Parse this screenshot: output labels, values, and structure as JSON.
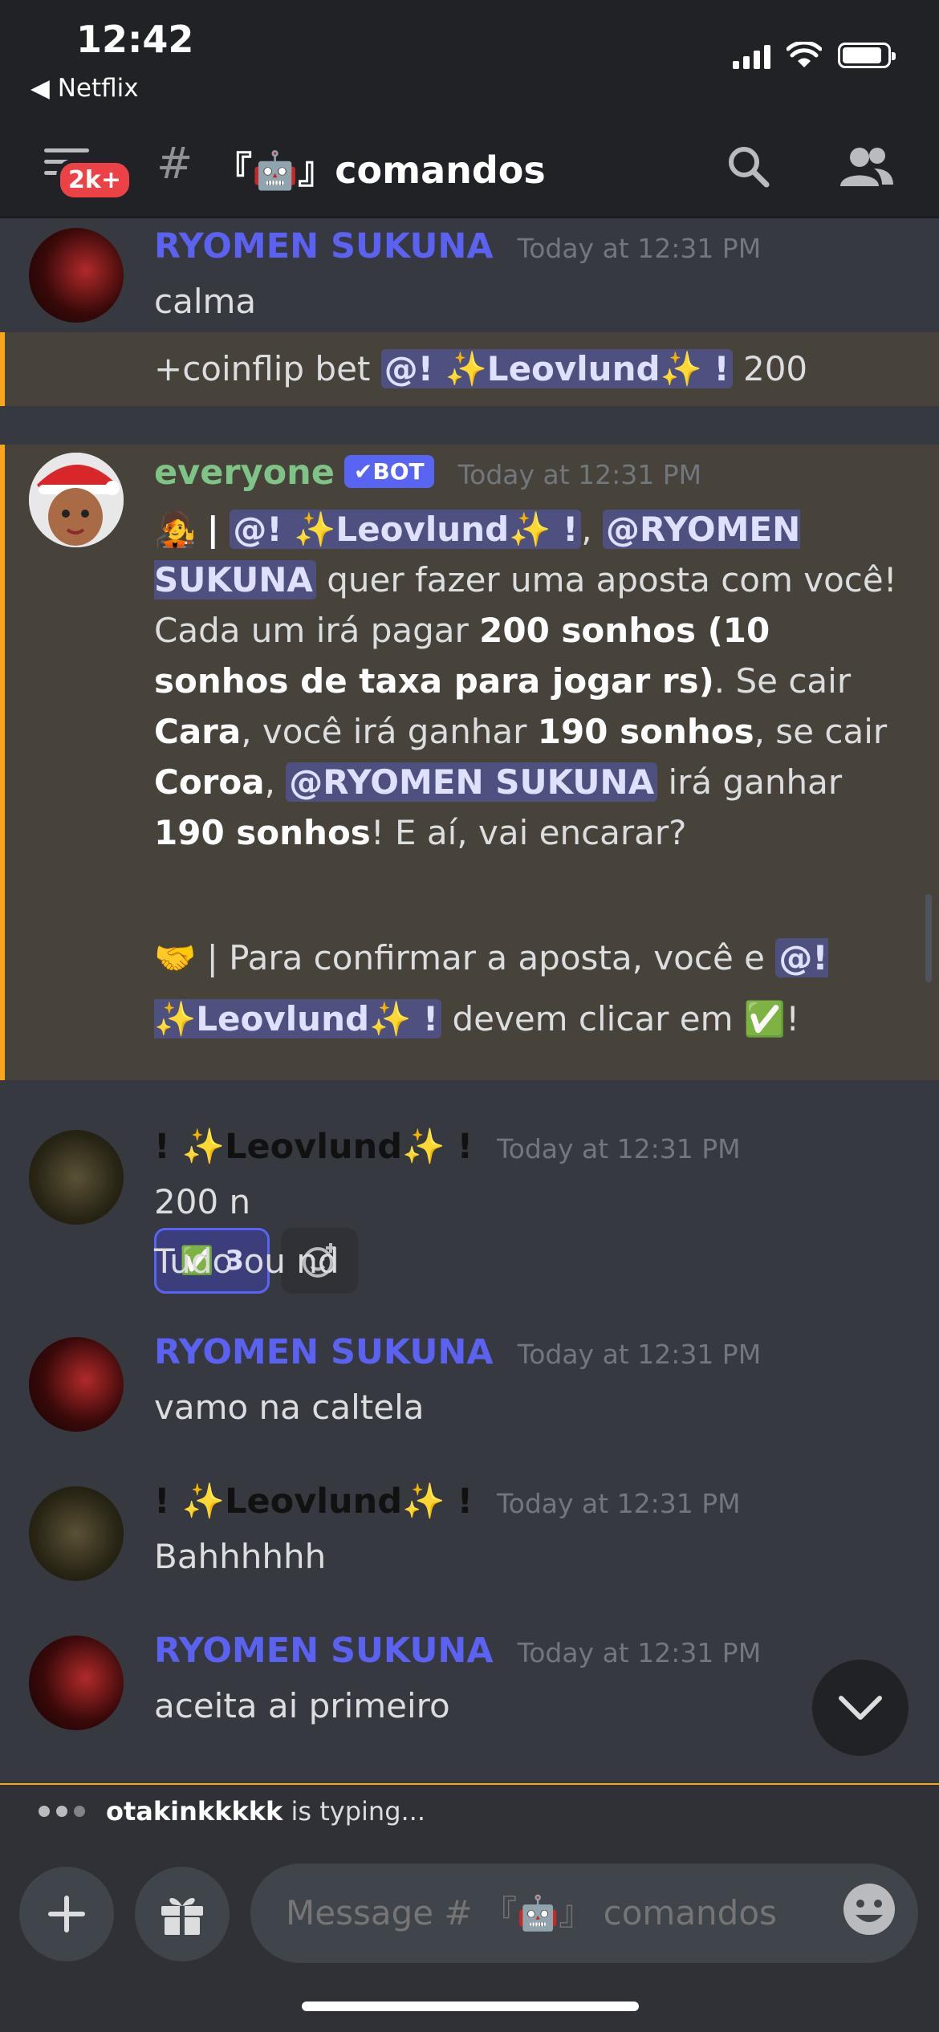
{
  "status_bar": {
    "time": "12:42",
    "back_app": "◀ Netflix"
  },
  "header": {
    "badge": "2k+",
    "hash": "#",
    "channel": "『🤖』comandos"
  },
  "messages": [
    {
      "user": "RYOMEN SUKUNA",
      "timestamp": "Today at 12:31 PM",
      "lines": [
        "calma",
        "+coinflip bet "
      ],
      "mention": "@! ✨Leovlund✨ !",
      "suffix": " 200"
    },
    {
      "user": "everyone",
      "bot_tag": "✔BOT",
      "timestamp": "Today at 12:31 PM"
    },
    {
      "user": "! ✨Leovlund✨ !",
      "timestamp": "Today at 12:31 PM",
      "lines": [
        "200 n",
        "Tudo ou nd"
      ]
    },
    {
      "user": "RYOMEN SUKUNA",
      "timestamp": "Today at 12:31 PM",
      "lines": [
        "vamo na caltela"
      ]
    },
    {
      "user": "! ✨Leovlund✨ !",
      "timestamp": "Today at 12:31 PM",
      "lines": [
        "Bahhhhhh"
      ]
    },
    {
      "user": "RYOMEN SUKUNA",
      "timestamp": "Today at 12:31 PM",
      "lines": [
        "aceita ai primeiro"
      ]
    }
  ],
  "bot_message": {
    "mention_leo": "@! ✨Leovlund✨ !",
    "mention_ryomen": "@RYOMEN SUKUNA",
    "p1_a": " quer fazer uma aposta com você! Cada um irá pagar ",
    "p1_b": "200 sonhos (10 sonhos de taxa para jogar rs)",
    "p1_c": ". Se cair ",
    "p1_d": "Cara",
    "p1_e": ", você irá ganhar ",
    "p1_f": "190 sonhos",
    "p1_g": ", se cair ",
    "p1_h": "Coroa",
    "p1_i": " irá ganhar ",
    "p1_j": "190 sonhos",
    "p1_k": "! E aí, vai encarar?",
    "p2_a": "🤝 | Para confirmar a aposta, você e ",
    "p2_b": " devem clicar em ✅!",
    "reaction_emoji": "✅",
    "reaction_count": "3"
  },
  "typing": {
    "user": "otakinkkkkk",
    "suffix": " is typing..."
  },
  "composer": {
    "placeholder": "Message # 『🤖』 comandos"
  },
  "colors": {
    "accent": "#5865f2",
    "highlight": "#faa61a",
    "background": "#36393f"
  }
}
